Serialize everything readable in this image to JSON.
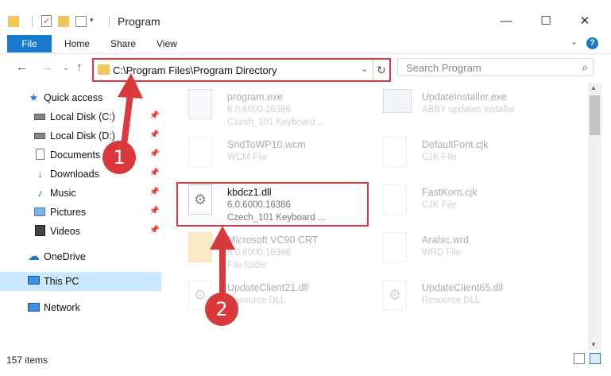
{
  "window": {
    "title": "Program",
    "minimize_glyph": "—",
    "maximize_glyph": "☐",
    "close_glyph": "✕"
  },
  "ribbon": {
    "tabs": [
      "File",
      "Home",
      "Share",
      "View"
    ],
    "help": "?"
  },
  "address": {
    "path": "C:\\Program Files\\Program Directory",
    "search_placeholder": "Search Program"
  },
  "navpane": {
    "items": [
      {
        "label": "Quick access",
        "icon": "star-icon",
        "pinned": false,
        "selected": false
      },
      {
        "label": "Local Disk (C:)",
        "icon": "drive-icon",
        "pinned": true,
        "selected": false
      },
      {
        "label": "Local Disk (D:)",
        "icon": "drive-icon",
        "pinned": true,
        "selected": false
      },
      {
        "label": "Documents",
        "icon": "documents-icon",
        "pinned": true,
        "selected": false
      },
      {
        "label": "Downloads",
        "icon": "download-icon",
        "pinned": true,
        "selected": false
      },
      {
        "label": "Music",
        "icon": "music-icon",
        "pinned": true,
        "selected": false
      },
      {
        "label": "Pictures",
        "icon": "pictures-icon",
        "pinned": true,
        "selected": false
      },
      {
        "label": "Videos",
        "icon": "videos-icon",
        "pinned": true,
        "selected": false
      },
      {
        "label": "OneDrive",
        "icon": "cloud-icon",
        "pinned": false,
        "selected": false
      },
      {
        "label": "This PC",
        "icon": "computer-icon",
        "pinned": false,
        "selected": true
      },
      {
        "label": "Network",
        "icon": "network-icon",
        "pinned": false,
        "selected": false
      }
    ]
  },
  "files": [
    {
      "name": "program.exe",
      "sub1": "6.0.6000.16386",
      "sub2": "Czech_101 Keyboard ...",
      "faded": true
    },
    {
      "name": "UpdateInstaller.exe",
      "sub1": "ABBY updates installer",
      "sub2": "",
      "faded": true
    },
    {
      "name": "SndToWP10.wcm",
      "sub1": "WCM File",
      "sub2": "",
      "faded": true
    },
    {
      "name": "DefaultFont.cjk",
      "sub1": "CJK File",
      "sub2": "",
      "faded": true
    },
    {
      "name": "kbdcz1.dll",
      "sub1": "6.0.6000.16386",
      "sub2": "Czech_101 Keyboard ...",
      "faded": false
    },
    {
      "name": "FastKorn.cjk",
      "sub1": "CJK File",
      "sub2": "",
      "faded": true
    },
    {
      "name": "Microsoft VC90 CRT",
      "sub1": "6.0.6000.16386",
      "sub2": "File folder",
      "faded": true
    },
    {
      "name": "Arabic.wrd",
      "sub1": "WRD File",
      "sub2": "",
      "faded": true
    },
    {
      "name": "UpdateClient21.dll",
      "sub1": "Resource DLL",
      "sub2": "",
      "faded": true
    },
    {
      "name": "UpdateClient65.dll",
      "sub1": "Resource DLL",
      "sub2": "",
      "faded": true
    }
  ],
  "status": {
    "items_count": "157 items"
  },
  "annotations": {
    "step1": "1",
    "step2": "2"
  },
  "colors": {
    "accent": "#1979ca",
    "annotation": "#d9393a",
    "selection": "#cce8ff"
  }
}
